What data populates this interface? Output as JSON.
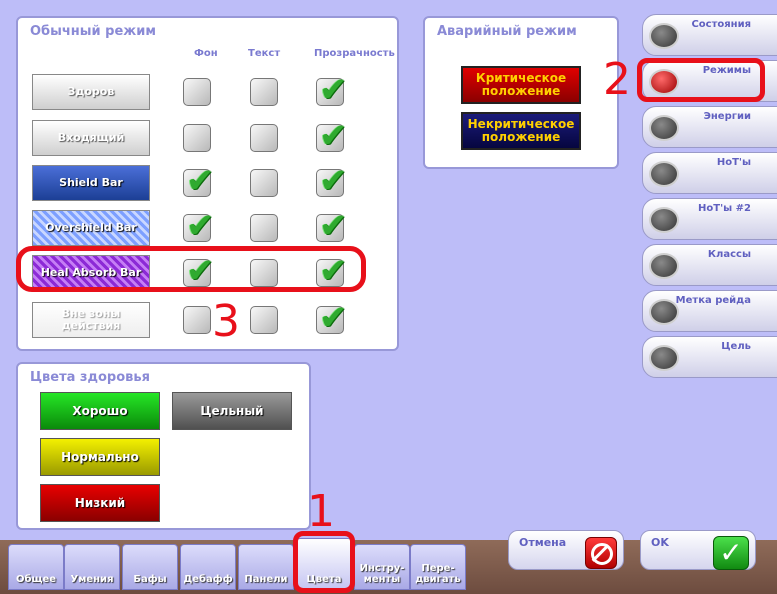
{
  "normal_mode": {
    "title": "Обычный режим",
    "columns": [
      "Фон",
      "Текст",
      "Прозрачность"
    ],
    "rows": [
      {
        "label": "Здоров",
        "bg": false,
        "text": false,
        "alpha": true
      },
      {
        "label": "Входящий",
        "bg": false,
        "text": false,
        "alpha": true
      },
      {
        "label": "Shield Bar",
        "bg": true,
        "text": false,
        "alpha": true
      },
      {
        "label": "Overshield Bar",
        "bg": true,
        "text": false,
        "alpha": true
      },
      {
        "label": "Heal Absorb Bar",
        "bg": true,
        "text": false,
        "alpha": true
      },
      {
        "label": "Вне зоны действия",
        "bg": false,
        "text": false,
        "alpha": true
      }
    ]
  },
  "emergency_mode": {
    "title": "Аварийный режим",
    "critical": "Критическое положение",
    "noncritical": "Некритическое положение"
  },
  "health_colors": {
    "title": "Цвета здоровья",
    "good": "Хорошо",
    "solid": "Цельный",
    "normal": "Нормально",
    "low": "Низкий"
  },
  "side_menu": [
    {
      "label": "Состояния",
      "active": false
    },
    {
      "label": "Режимы",
      "active": true
    },
    {
      "label": "Энергии",
      "active": false
    },
    {
      "label": "HoT'ы",
      "active": false
    },
    {
      "label": "HoT'ы #2",
      "active": false
    },
    {
      "label": "Классы",
      "active": false
    },
    {
      "label": "Метка рейда",
      "active": false
    },
    {
      "label": "Цель",
      "active": false
    }
  ],
  "bottom_tabs": [
    "Общее",
    "Умения",
    "Бафы",
    "Дебафф",
    "Панели",
    "Цвета",
    "Инстру-менты",
    "Пере-двигать"
  ],
  "buttons": {
    "cancel": "Отмена",
    "ok": "OK"
  },
  "annotations": [
    "1",
    "2",
    "3"
  ],
  "colors": {
    "accent": "#e8101a",
    "panel_title": "#8a8ad6"
  }
}
